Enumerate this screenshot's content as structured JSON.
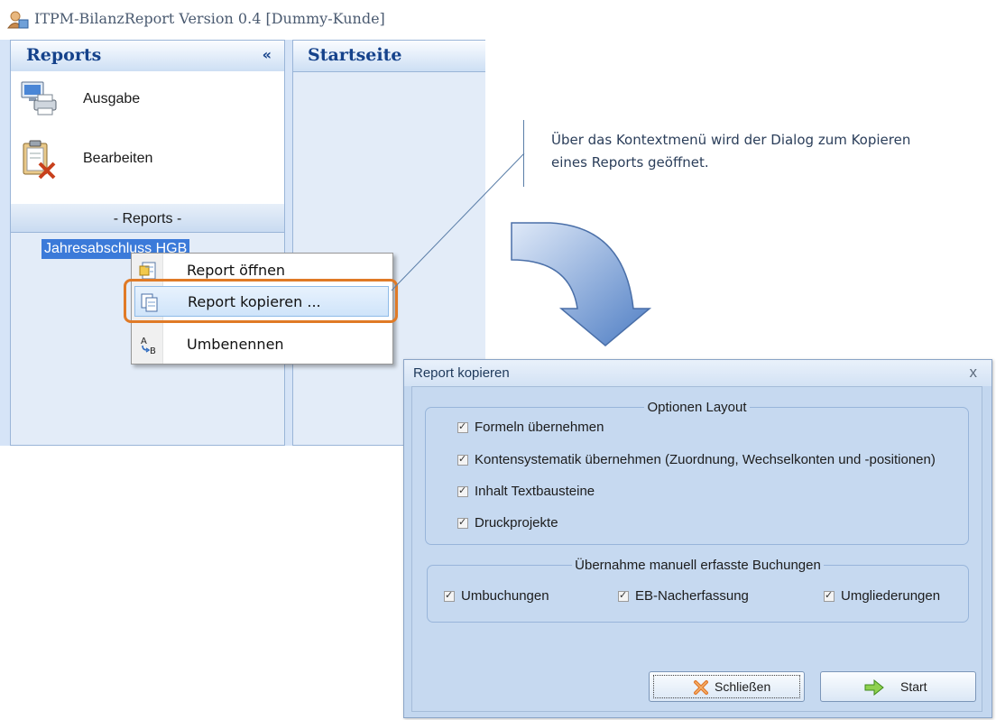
{
  "app": {
    "title": "ITPM-BilanzReport Version 0.4  [Dummy-Kunde]",
    "left_panel": {
      "title": "Reports",
      "collapse_glyph": "«",
      "nav_items": [
        {
          "label": "Ausgabe",
          "icon": "printer-computer-icon"
        },
        {
          "label": "Bearbeiten",
          "icon": "clipboard-edit-icon"
        }
      ],
      "group_header": "- Reports -",
      "tree_item": "Jahresabschluss HGB"
    },
    "right_panel": {
      "title": "Startseite"
    }
  },
  "context_menu": {
    "items": [
      {
        "label": "Report öffnen",
        "icon": "report-open-icon"
      },
      {
        "label": "Report kopieren ...",
        "icon": "report-copy-icon"
      },
      {
        "label": "Umbenennen",
        "icon": "rename-icon"
      }
    ],
    "highlighted": "Report kopieren ..."
  },
  "annotation": {
    "text": "Über das Kontextmenü wird der Dialog zum Kopieren eines Reports geöffnet."
  },
  "dialog": {
    "title": "Report kopieren",
    "close_glyph": "x",
    "group_layout": {
      "title": "Optionen Layout",
      "options": [
        {
          "label": "Formeln übernehmen",
          "checked": true
        },
        {
          "label": "Kontensystematik übernehmen (Zuordnung, Wechselkonten und -positionen)",
          "checked": true
        },
        {
          "label": "Inhalt Textbausteine",
          "checked": true
        },
        {
          "label": "Druckprojekte",
          "checked": true
        }
      ]
    },
    "group_bookings": {
      "title": "Übernahme manuell erfasste Buchungen",
      "options": [
        {
          "label": "Umbuchungen",
          "checked": true
        },
        {
          "label": "EB-Nacherfassung",
          "checked": true
        },
        {
          "label": "Umgliederungen",
          "checked": true
        }
      ]
    },
    "buttons": {
      "close": "Schließen",
      "start": "Start"
    }
  },
  "colors": {
    "panel_header_text": "#15428b",
    "selection": "#3b7ad9",
    "highlight_border": "#e07a26",
    "arrow": "#5b86c9",
    "dialog_bg": "#c6d9f0"
  }
}
